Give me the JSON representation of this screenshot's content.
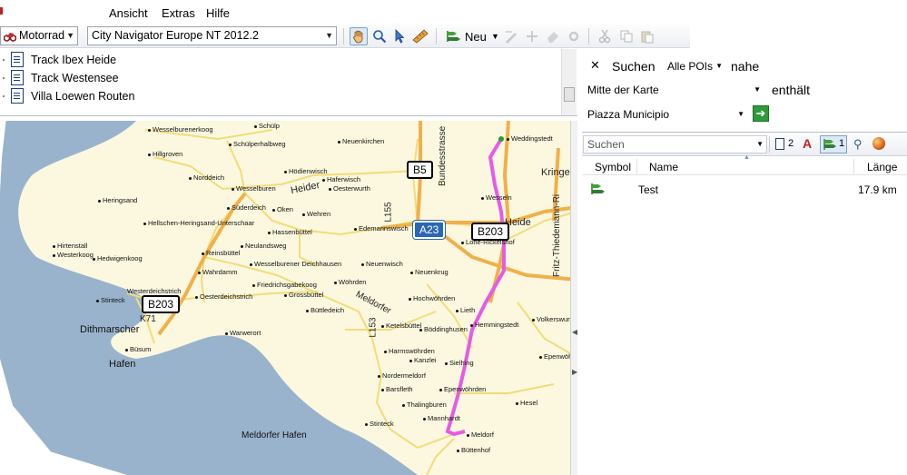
{
  "menu": {
    "items": [
      "Ansicht",
      "Extras",
      "Hilfe"
    ]
  },
  "toolbar": {
    "profile": "Motorrad",
    "map_product": "City Navigator Europe NT 2012.2",
    "new_label": "Neu"
  },
  "tracks": [
    "Track Ibex Heide",
    "Track Westensee",
    "Villa Loewen Routen"
  ],
  "search": {
    "title": "Suchen",
    "category": "Alle POIs",
    "near_label": "nahe",
    "near_value": "Mitte der Karte",
    "contains_label": "enthält",
    "query": "Piazza Municipio"
  },
  "results": {
    "filter_placeholder": "Suchen",
    "doc_count": "2",
    "route_count": "1",
    "columns": {
      "symbol": "Symbol",
      "name": "Name",
      "length": "Länge"
    },
    "rows": [
      {
        "name": "Test",
        "length": "17.9 km"
      }
    ]
  },
  "map": {
    "shields": {
      "b5": "B5",
      "a23": "A23",
      "b203_east": "B203",
      "b203_west": "B203"
    },
    "roads": {
      "l155": "L155",
      "l153": "L153",
      "k71": "K71",
      "bundesstrasse": "Bundesstrasse",
      "heider": "Heider",
      "heide": "Heide",
      "meldorfer": "Meldorfer",
      "kringel": "Kringel",
      "fritz": "Fritz-Thiedemann-Ri"
    },
    "places": {
      "schuelp": "Schülp",
      "wesselburenerkoog": "Wesselburenerkoog",
      "neuenkirchen": "Neuenkirchen",
      "hillgroven": "Hillgroven",
      "schuelperhalbweg": "Schülperhalbweg",
      "weddingstedt": "Weddingstedt",
      "norddeich": "Norddeich",
      "wesselburen": "Wesselburen",
      "hoedienwisch": "Hödienwisch",
      "haferwisch": "Haferwisch",
      "oesterwurth": "Oesterwurth",
      "heringsand": "Heringsand",
      "suederdeich": "Süderdeich",
      "oken": "Oken",
      "wehren": "Wehren",
      "wesseln": "Wesseln",
      "hellschen": "Hellschen-Heringsand-Unterschaar",
      "hassenbuettel": "Hassenbüttel",
      "edemannswisch": "Edemannswisch",
      "hirtenstall": "Hirtenstall",
      "westerkoog": "Westerkoog",
      "hedwigenkoog": "Hedwigenkoog",
      "reinsbuettel": "Reinsbüttel",
      "neulandsweg": "Neulandsweg",
      "lohe": "Lohe-Rickelshof",
      "wahrdamm": "Wahrdamm",
      "wesselburener_deichhausen": "Wesselburener Deichhausen",
      "neuenwisch": "Neuenwisch",
      "neuenkrug": "Neuenkrug",
      "woehrden": "Wöhrden",
      "friedrichsgabekoog": "Friedrichsgabekoog",
      "westerdeichstrich": "Westerdeichstrich",
      "stinteck_w": "Stinteck",
      "oesterdeichstrich": "Oesterdeichstrich",
      "grossbuettel": "Grossbüttel",
      "hochwoehrden": "Hochwöhrden",
      "lieth": "Lieth",
      "buettledeich": "Büttledeich",
      "hemmingstedt": "Hemmingstedt",
      "volkerswurth": "Volkerswurth",
      "dithmarscher": "Dithmarscher",
      "ketelsbuettel": "Ketelsbüttel",
      "boeddinghusen": "Böddinghusen",
      "warwerort": "Warwerort",
      "buesum": "Büsum",
      "harmswoehrden": "Harmswöhrden",
      "epenwoehrden": "Epenwöhrden",
      "hafen": "Hafen",
      "kanzlei": "Kanzlei",
      "nordermeldorf": "Nordermeldorf",
      "sielhing": "Sielhing",
      "barsfleth": "Barsfleth",
      "epenwoehrden2": "Epenwöhrden",
      "thalingburen": "Thalingburen",
      "hesel": "Hesel",
      "stinteck_e": "Stinteck",
      "mannhardt": "Mannhardt",
      "meldorf": "Meldorf",
      "meldorfer_hafen": "Meldorfer Hafen",
      "buttenhof": "Büttenhof"
    }
  },
  "colors": {
    "water": "#99b3cc",
    "land": "#fbf8df",
    "road_major": "#f0b04a",
    "road_minor": "#f2dc7a",
    "route": "#e65be6",
    "accent": "#2b66b4"
  }
}
